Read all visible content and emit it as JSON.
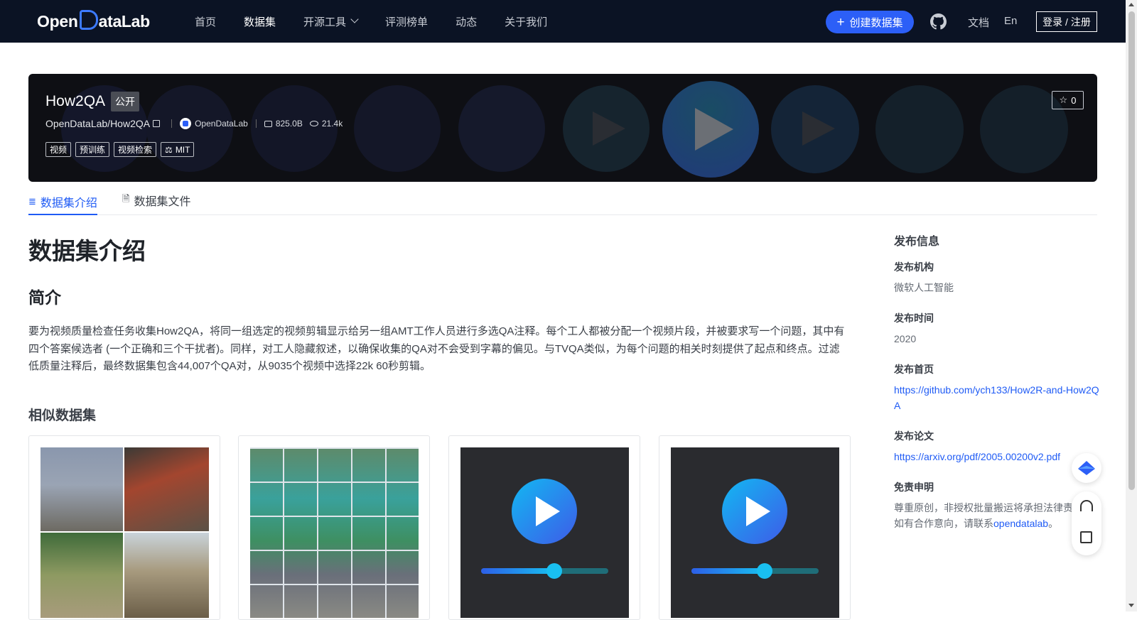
{
  "nav": {
    "logo": "OpenDataLab",
    "items": [
      {
        "label": "首页",
        "active": false
      },
      {
        "label": "数据集",
        "active": true
      },
      {
        "label": "开源工具",
        "active": false,
        "dropdown": true
      },
      {
        "label": "评测榜单",
        "active": false
      },
      {
        "label": "动态",
        "active": false
      },
      {
        "label": "关于我们",
        "active": false
      }
    ],
    "create_label": "创建数据集",
    "docs_label": "文档",
    "lang_label": "En",
    "login_label": "登录 / 注册",
    "github_icon": "github-icon"
  },
  "banner": {
    "title": "How2QA",
    "visibility": "公开",
    "path": "OpenDataLab/How2QA",
    "org": "OpenDataLab",
    "size": "825.0B",
    "views": "21.4k",
    "tags": [
      "视频",
      "预训练",
      "视频检索"
    ],
    "license": "MIT",
    "stars": "0"
  },
  "tabs": [
    {
      "label": "数据集介绍",
      "active": true,
      "icon": "database-icon"
    },
    {
      "label": "数据集文件",
      "active": false,
      "icon": "file-icon"
    }
  ],
  "main": {
    "title": "数据集介绍",
    "section": "简介",
    "intro": "要为视频质量检查任务收集How2QA，将同一组选定的视频剪辑显示给另一组AMT工作人员进行多选QA注释。每个工人都被分配一个视频片段，并被要求写一个问题，其中有四个答案候选者 (一个正确和三个干扰者)。同样，对工人隐藏叙述，以确保收集的QA对不会受到字幕的偏见。与TVQA类似，为每个问题的相关时刻提供了起点和终点。过滤低质量注释后，最终数据集包含44,007个QA对，从9035个视频中选择22k 60秒剪辑。",
    "similar_title": "相似数据集"
  },
  "sidebar": {
    "heading": "发布信息",
    "org_label": "发布机构",
    "org_value": "微软人工智能",
    "time_label": "发布时间",
    "time_value": "2020",
    "home_label": "发布首页",
    "home_value": "https://github.com/ych133/How2R-and-How2QA",
    "paper_label": "发布论文",
    "paper_value": "https://arxiv.org/pdf/2005.00200v2.pdf",
    "disclaimer_label": "免责申明",
    "disclaimer_text": "尊重原创，非授权批量搬运将承担法律责任",
    "disclaimer_text2": "如有合作意向，请联系",
    "disclaimer_link": "opendatalab",
    "disclaimer_end": "。"
  },
  "colors": {
    "nav_bg": "#0b1324",
    "accent": "#2c5ff7",
    "link": "#1f5bf5"
  }
}
